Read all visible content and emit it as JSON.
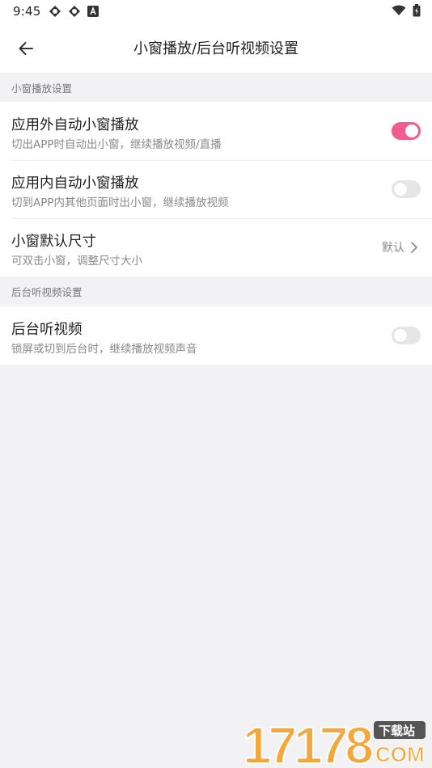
{
  "status_bar": {
    "time": "9:45",
    "left_icons": [
      "sync-icon",
      "sync-icon",
      "font-a-icon"
    ],
    "right_icons": [
      "wifi-icon",
      "battery-charging-icon"
    ]
  },
  "app_bar": {
    "back_icon": "arrow-left-icon",
    "title": "小窗播放/后台听视频设置"
  },
  "sections": [
    {
      "header": "小窗播放设置",
      "items": [
        {
          "title": "应用外自动小窗播放",
          "subtitle": "切出APP时自动出小窗，继续播放视频/直播",
          "control": "toggle",
          "on": true
        },
        {
          "title": "应用内自动小窗播放",
          "subtitle": "切到APP内其他页面时出小窗，继续播放视频",
          "control": "toggle",
          "on": false
        },
        {
          "title": "小窗默认尺寸",
          "subtitle": "可双击小窗，调整尺寸大小",
          "control": "value",
          "value": "默认"
        }
      ]
    },
    {
      "header": "后台听视频设置",
      "items": [
        {
          "title": "后台听视频",
          "subtitle": "锁屏或切到后台时，继续播放视频声音",
          "control": "toggle",
          "on": false
        }
      ]
    }
  ],
  "colors": {
    "accent": "#f25d8e",
    "background": "#f2f2f4",
    "toggle_off": "#e6e6e6"
  },
  "watermark": {
    "number": "17178",
    "tag": "下载站",
    "domain": "COM"
  }
}
